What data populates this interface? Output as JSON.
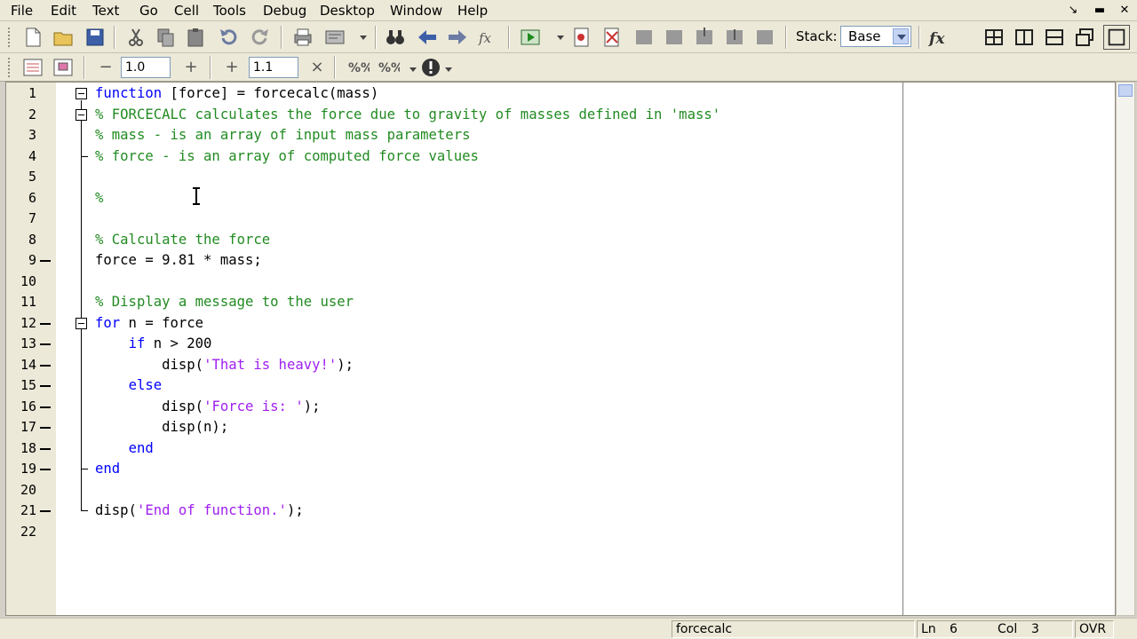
{
  "menu": [
    "File",
    "Edit",
    "Text",
    "Go",
    "Cell",
    "Tools",
    "Debug",
    "Desktop",
    "Window",
    "Help"
  ],
  "toolbar": {
    "stack_label": "Stack:",
    "stack_value": "Base"
  },
  "cell_toolbar": {
    "decrement_value": "1.0",
    "increment_value": "1.1"
  },
  "editor": {
    "lines": [
      {
        "n": "1",
        "parts": [
          {
            "t": "kw",
            "s": "function"
          },
          {
            "t": "pl",
            "s": " [force] = forcecalc(mass)"
          }
        ]
      },
      {
        "n": "2",
        "parts": [
          {
            "t": "cm",
            "s": "% FORCECALC calculates the force due to gravity of masses defined in 'mass'"
          }
        ]
      },
      {
        "n": "3",
        "parts": [
          {
            "t": "cm",
            "s": "% mass - is an array of input mass parameters"
          }
        ]
      },
      {
        "n": "4",
        "parts": [
          {
            "t": "cm",
            "s": "% force - is an array of computed force values"
          }
        ]
      },
      {
        "n": "5",
        "parts": []
      },
      {
        "n": "6",
        "parts": [
          {
            "t": "cm",
            "s": "%"
          }
        ]
      },
      {
        "n": "7",
        "parts": []
      },
      {
        "n": "8",
        "parts": [
          {
            "t": "cm",
            "s": "% Calculate the force"
          }
        ]
      },
      {
        "n": "9",
        "parts": [
          {
            "t": "pl",
            "s": "force = 9.81 * mass;"
          }
        ]
      },
      {
        "n": "10",
        "parts": []
      },
      {
        "n": "11",
        "parts": [
          {
            "t": "cm",
            "s": "% Display a message to the user"
          }
        ]
      },
      {
        "n": "12",
        "parts": [
          {
            "t": "kw",
            "s": "for"
          },
          {
            "t": "pl",
            "s": " n = force"
          }
        ]
      },
      {
        "n": "13",
        "parts": [
          {
            "t": "pl",
            "s": "    "
          },
          {
            "t": "kw",
            "s": "if"
          },
          {
            "t": "pl",
            "s": " n > 200"
          }
        ]
      },
      {
        "n": "14",
        "parts": [
          {
            "t": "pl",
            "s": "        disp("
          },
          {
            "t": "str",
            "s": "'That is heavy!'"
          },
          {
            "t": "pl",
            "s": ");"
          }
        ]
      },
      {
        "n": "15",
        "parts": [
          {
            "t": "pl",
            "s": "    "
          },
          {
            "t": "kw",
            "s": "else"
          }
        ]
      },
      {
        "n": "16",
        "parts": [
          {
            "t": "pl",
            "s": "        disp("
          },
          {
            "t": "str",
            "s": "'Force is: '"
          },
          {
            "t": "pl",
            "s": ");"
          }
        ]
      },
      {
        "n": "17",
        "parts": [
          {
            "t": "pl",
            "s": "        disp(n);"
          }
        ]
      },
      {
        "n": "18",
        "parts": [
          {
            "t": "pl",
            "s": "    "
          },
          {
            "t": "kw",
            "s": "end"
          }
        ]
      },
      {
        "n": "19",
        "parts": [
          {
            "t": "kw",
            "s": "end"
          }
        ]
      },
      {
        "n": "20",
        "parts": []
      },
      {
        "n": "21",
        "parts": [
          {
            "t": "pl",
            "s": "disp("
          },
          {
            "t": "str",
            "s": "'End of function.'"
          },
          {
            "t": "pl",
            "s": ");"
          }
        ]
      },
      {
        "n": "22",
        "parts": []
      }
    ],
    "breakpoint_marker_lines": [
      "9",
      "12",
      "13",
      "14",
      "15",
      "16",
      "17",
      "18",
      "19",
      "21"
    ]
  },
  "statusbar": {
    "function_name": "forcecalc",
    "ln_label": "Ln",
    "ln_value": "6",
    "col_label": "Col",
    "col_value": "3",
    "mode": "OVR"
  },
  "colors": {
    "keyword": "#0000ff",
    "comment": "#228b22",
    "string": "#a020f0",
    "chrome": "#ece9d8"
  }
}
